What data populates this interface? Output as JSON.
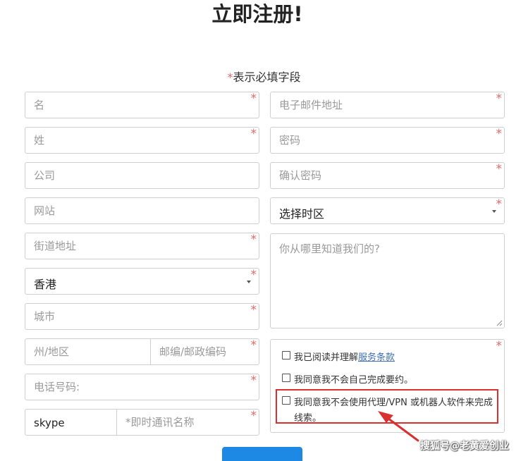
{
  "page_title": "立即注册!",
  "required_note": {
    "star": "*",
    "text": "表示必填字段"
  },
  "required_mark": "*",
  "form": {
    "first_name_placeholder": "名",
    "last_name_placeholder": "姓",
    "company_placeholder": "公司",
    "website_placeholder": "网站",
    "street_placeholder": "街道地址",
    "country_value": "香港",
    "city_placeholder": "城市",
    "state_placeholder": "州/地区",
    "postcode_placeholder": "邮编/邮政编码",
    "phone_placeholder": "电话号码:",
    "im_type_value": "skype",
    "im_name_placeholder": "*即时通讯名称",
    "email_placeholder": "电子邮件地址",
    "password_placeholder": "密码",
    "confirm_password_placeholder": "确认密码",
    "timezone_value": "选择时区",
    "referral_placeholder": "你从哪里知道我们的?"
  },
  "agreements": {
    "terms_prefix": "我已阅读并理解",
    "terms_link": "服务条款",
    "no_self_order": "我同意我不会自己完成要约。",
    "no_proxy_line1": "我同意我不会使用代理/VPN 或机器人软件来完成",
    "no_proxy_line2": "线索。"
  },
  "watermark": "搜狐号@老黄爱创业",
  "colors": {
    "required_star": "#e06a6a",
    "highlight_border": "#d9312f",
    "arrow": "#d9312f",
    "link": "#3d6fb7",
    "submit_button": "#1e88e5"
  }
}
